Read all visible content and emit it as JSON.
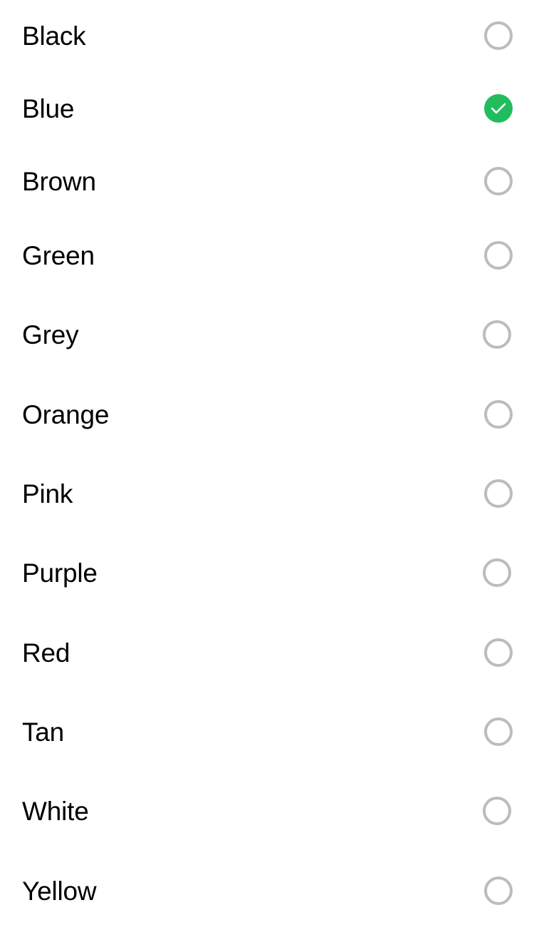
{
  "options": [
    {
      "label": "Black",
      "selected": false
    },
    {
      "label": "Blue",
      "selected": true
    },
    {
      "label": "Brown",
      "selected": false
    },
    {
      "label": "Green",
      "selected": false
    },
    {
      "label": "Grey",
      "selected": false
    },
    {
      "label": "Orange",
      "selected": false
    },
    {
      "label": "Pink",
      "selected": false
    },
    {
      "label": "Purple",
      "selected": false
    },
    {
      "label": "Red",
      "selected": false
    },
    {
      "label": "Tan",
      "selected": false
    },
    {
      "label": "White",
      "selected": false
    },
    {
      "label": "Yellow",
      "selected": false
    }
  ],
  "colors": {
    "selected_fill": "#22bc5f",
    "unselected_ring": "#bcbcbc"
  },
  "icons": {
    "selected": "checkmark-circle-icon",
    "unselected": "empty-circle-icon"
  }
}
